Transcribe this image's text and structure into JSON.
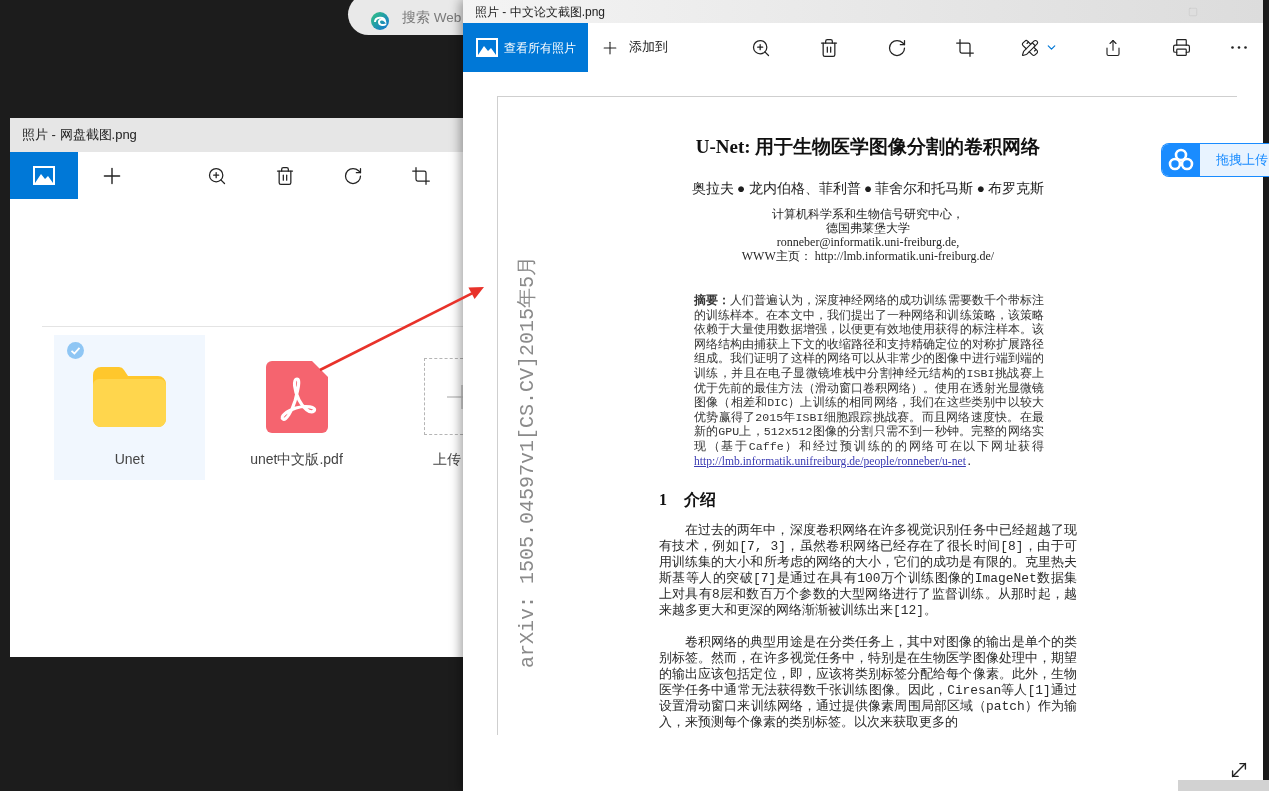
{
  "desktop": {
    "search_box": {
      "placeholder": "搜索 Web"
    }
  },
  "back_window": {
    "title": "照片 - 网盘截图.png",
    "files": [
      {
        "name": "Unet",
        "kind": "folder",
        "selected": true
      },
      {
        "name": "unet中文版.pdf",
        "kind": "pdf",
        "selected": false
      },
      {
        "name": "上传",
        "kind": "upload",
        "selected": false
      }
    ]
  },
  "front_window": {
    "title": "照片 - 中文论文截图.png",
    "toolbar": {
      "view_all": "查看所有照片",
      "add_to": "添加到"
    }
  },
  "document": {
    "margin_note": "arXiv: 1505.04597v1[CS.CV]2015年5月",
    "title": "U-Net: 用于生物医学图像分割的卷积网络",
    "authors": "奥拉夫 ● 龙内伯格、菲利普 ● 菲舍尔和托马斯 ● 布罗克斯",
    "affiliation": [
      "计算机科学系和生物信号研究中心，",
      "德国弗莱堡大学",
      "ronneber@informatik.uni-freiburg.de,",
      "WWW主页： http://lmb.informatik.uni-freiburg.de/"
    ],
    "abstract": {
      "text": "**摘要：**人们普遍认为，深度神经网络的成功训练需要数千个带标注的训练样本。在本文中，我们提出了一种网络和训练策略，该策略依赖于大量使用数据增强，以便更有效地使用获得的标注样本。该网络结构由捕获上下文的收缩路径和支持精确定位的对称扩展路径组成。我们证明了这样的网络可以从非常少的图像中进行端到端的训练，并且在电子显微镜堆栈中分割神经元结构的ISBI挑战赛上优于先前的最佳方法（滑动窗口卷积网络）。使用在透射光显微镜图像（相差和DIC）上训练的相同网络，我们在这些类别中以较大优势赢得了2015年ISBI细胞跟踪挑战赛。而且网络速度快。在最新的GPU上，512x512图像的分割只需不到一秒钟。完整的网络实现（基于Caffe）和经过预训练的的网络可在以下网址获得",
      "link": "http://lmb.informatik.unifreiburg.de/people/ronneber/u-net",
      "after_link": "."
    },
    "section": {
      "number": "1",
      "title": "介绍"
    },
    "paragraphs": [
      "在过去的两年中，深度卷积网络在许多视觉识别任务中已经超越了现有技术，例如[7, 3]，虽然卷积网络已经存在了很长时间[8]，由于可用训练集的大小和所考虑的网络的大小，它们的成功是有限的。克里热夫斯基等人的突破[7]是通过在具有100万个训练图像的ImageNet数据集上对具有8层和数百万个参数的大型网络进行了监督训练。从那时起，越来越多更大和更深的网络渐渐被训练出来[12]。",
      "卷积网络的典型用途是在分类任务上，其中对图像的输出是单个的类别标签。然而，在许多视觉任务中，特别是在生物医学图像处理中，期望的输出应该包括定位，即，应该将类别标签分配给每个像素。此外，生物医学任务中通常无法获得数千张训练图像。因此，Ciresan等人[1]通过设置滑动窗口来训练网络，通过提供像素周围局部区域（patch）作为输入，来预测每个像素的类别标签。以次来获取更多的"
    ]
  },
  "upload_widget": {
    "label": "拖拽上传"
  }
}
